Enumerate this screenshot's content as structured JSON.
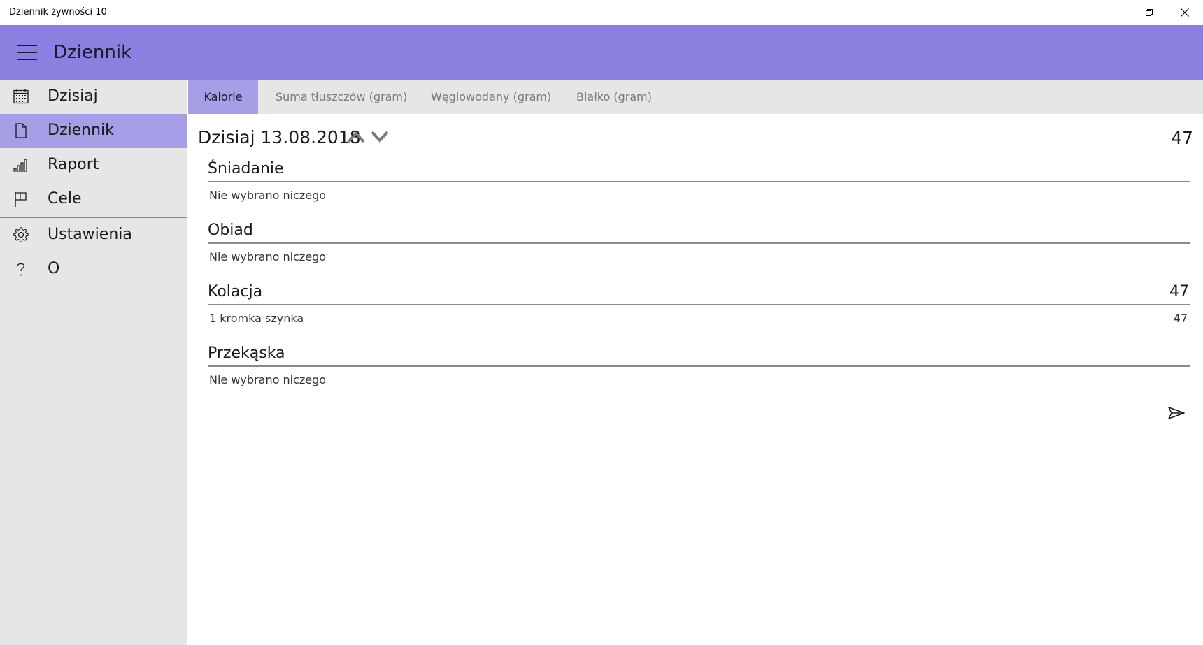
{
  "window": {
    "title": "Dziennik żywności 10",
    "controls": [
      "minimize-icon",
      "restore-icon",
      "close-icon"
    ]
  },
  "header": {
    "menu_icon": "hamburger-icon",
    "title": "Dziennik",
    "color": "#8b80e0"
  },
  "sidebar": {
    "items": [
      {
        "label": "Dzisiaj",
        "icon": "calendar-icon"
      },
      {
        "label": "Dziennik",
        "icon": "document-icon",
        "active": true
      },
      {
        "label": "Raport",
        "icon": "bar-chart-icon"
      },
      {
        "label": "Cele",
        "icon": "flag-icon"
      },
      {
        "label": "Ustawienia",
        "icon": "gear-icon"
      },
      {
        "label": "O",
        "icon": "question-icon"
      }
    ],
    "active_color": "#a69ee6"
  },
  "tabs": [
    {
      "label": "Kalorie",
      "active": true
    },
    {
      "label": "Suma tłuszczów (gram)"
    },
    {
      "label": "Węglowodany (gram)"
    },
    {
      "label": "Białko (gram)"
    }
  ],
  "day": {
    "date_label": "Dzisiaj 13.08.2018",
    "total": "47",
    "prev_icon": "chevron-up-icon",
    "next_icon": "chevron-down-icon"
  },
  "meals": [
    {
      "title": "Śniadanie",
      "total": "",
      "rows": [
        {
          "label": "Nie wybrano niczego",
          "value": ""
        }
      ]
    },
    {
      "title": "Obiad",
      "total": "",
      "rows": [
        {
          "label": "Nie wybrano niczego",
          "value": ""
        }
      ]
    },
    {
      "title": "Kolacja",
      "total": "47",
      "rows": [
        {
          "label": "1 kromka szynka",
          "value": "47"
        }
      ]
    },
    {
      "title": "Przekąska",
      "total": "",
      "rows": [
        {
          "label": "Nie wybrano niczego",
          "value": ""
        }
      ]
    }
  ],
  "actions": {
    "share_icon": "send-icon"
  }
}
